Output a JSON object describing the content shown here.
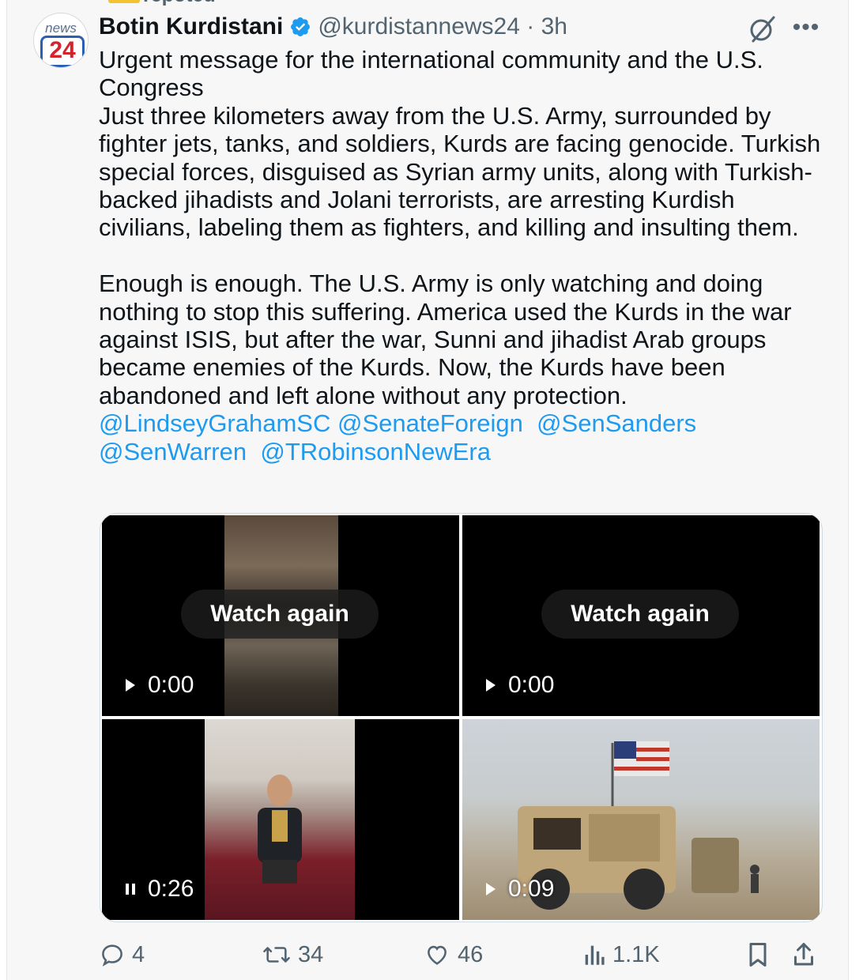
{
  "repost_banner": {
    "text": "repoted"
  },
  "tweet": {
    "author_name": "Botin Kurdistani",
    "author_handle": "@kurdistannews24 · 3h",
    "avatar": {
      "top_text": "news",
      "badge_text": "24"
    },
    "text_main": "Urgent message for the international community and the U.S. Congress\nJust three kilometers away from the U.S. Army, surrounded by fighter jets, tanks, and soldiers, Kurds are facing genocide. Turkish special forces, disguised as Syrian army units, along with Turkish-backed jihadists and Jolani terrorists, are arresting Kurdish civilians, labeling them as fighters, and killing and insulting them.\n\nEnough is enough. The U.S. Army is only watching and doing nothing to stop this suffering. America used the Kurds in the war against ISIS, but after the war, Sunni and jihadist Arab groups became enemies of the Kurds. Now, the Kurds have been abandoned and left alone without any protection.\n",
    "mentions": [
      "@LindseyGrahamSC",
      "@SenateForeign",
      "@SenSanders",
      "@SenWarren",
      "@TRobinsonNewEra"
    ]
  },
  "media": [
    {
      "overlay": "Watch again",
      "time": "0:00",
      "state": "play"
    },
    {
      "overlay": "Watch again",
      "time": "0:00",
      "state": "play"
    },
    {
      "overlay": "",
      "time": "0:26",
      "state": "pause"
    },
    {
      "overlay": "",
      "time": "0:09",
      "state": "play"
    }
  ],
  "actions": {
    "replies": "4",
    "reposts": "34",
    "likes": "46",
    "views": "1.1K"
  },
  "colors": {
    "accent": "#1d9bf0",
    "muted": "#536471",
    "text": "#0f1419"
  },
  "icons": [
    "verified-badge-icon",
    "grok-icon",
    "more-icon",
    "reply-icon",
    "repost-icon",
    "like-icon",
    "views-icon",
    "bookmark-icon",
    "share-icon",
    "play-icon",
    "pause-icon"
  ]
}
